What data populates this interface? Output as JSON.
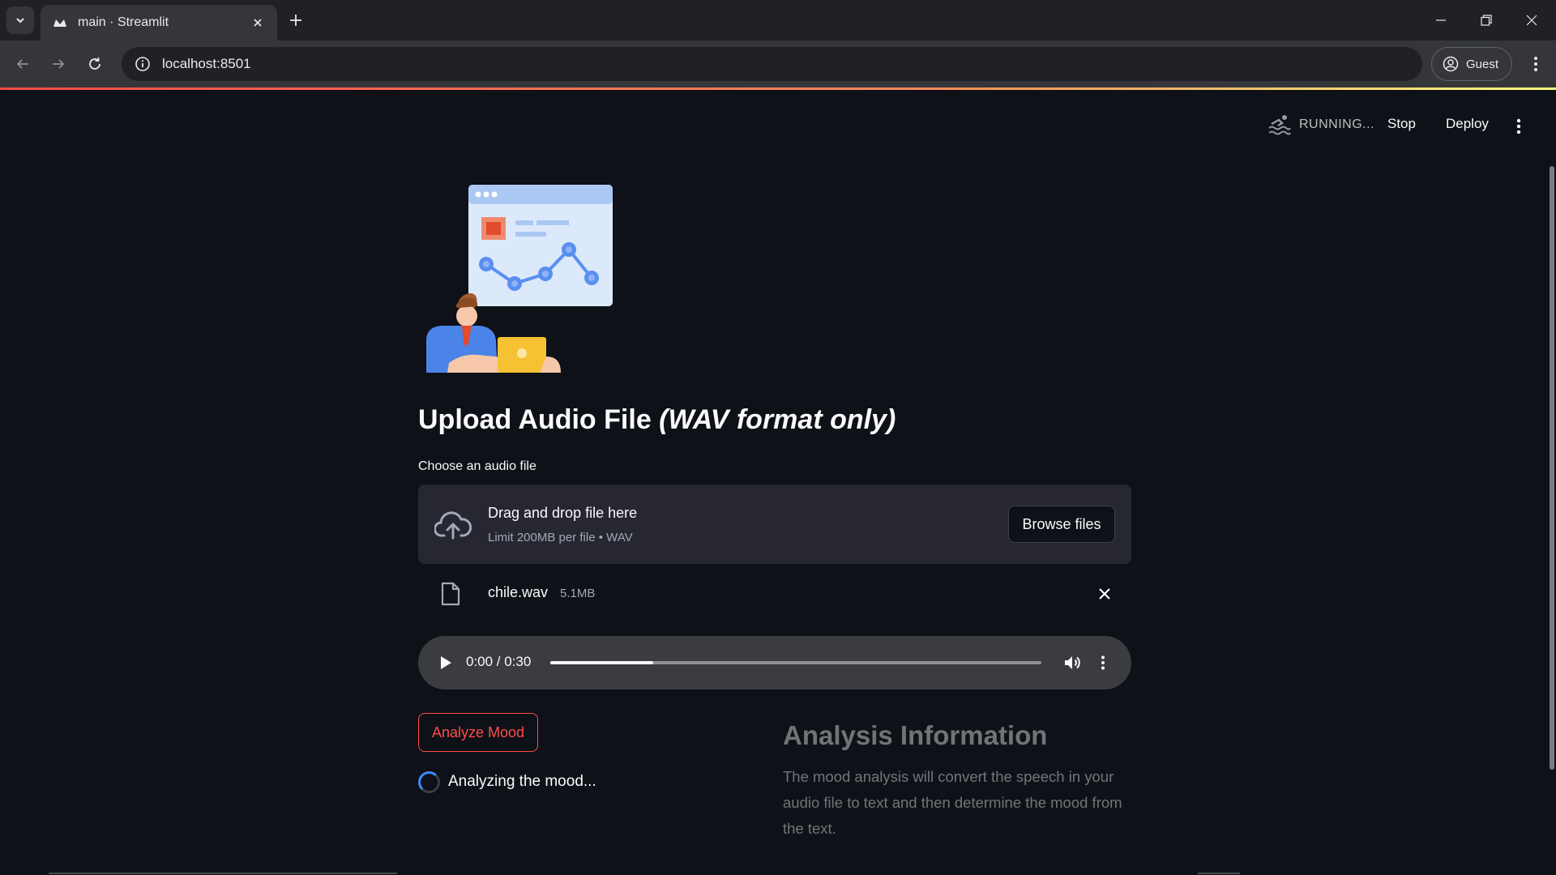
{
  "browser": {
    "tab_title": "main · Streamlit",
    "url": "localhost:8501",
    "profile_label": "Guest"
  },
  "app_header": {
    "status_text": "RUNNING...",
    "stop_label": "Stop",
    "deploy_label": "Deploy"
  },
  "main": {
    "heading_plain": "Upload Audio File ",
    "heading_italic": "(WAV format only)",
    "uploader_label": "Choose an audio file",
    "dropzone": {
      "title": "Drag and drop file here",
      "limit": "Limit 200MB per file • WAV",
      "browse_label": "Browse files"
    },
    "file": {
      "name": "chile.wav",
      "size": "5.1MB"
    },
    "audio": {
      "time": "0:00 / 0:30",
      "buffered_fraction": 0.21
    },
    "analyze_label": "Analyze Mood",
    "spinner_text": "Analyzing the mood..."
  },
  "info": {
    "title": "Analysis Information",
    "body": "The mood analysis will convert the speech in your audio file to text and then determine the mood from the text."
  },
  "colors": {
    "accent": "#ff4b4b",
    "background": "#0e1117",
    "secondary_bg": "#262730",
    "spinner": "#3d8bfd"
  }
}
